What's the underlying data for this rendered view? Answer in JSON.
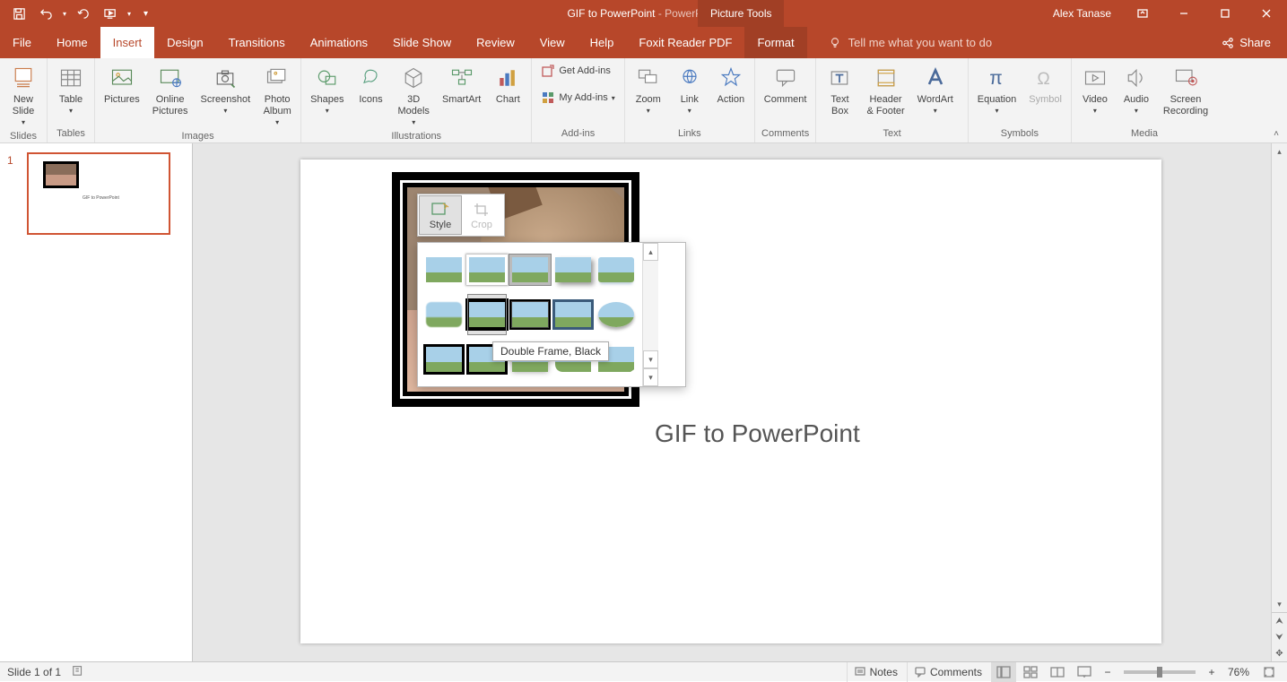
{
  "title": {
    "doc": "GIF to PowerPoint",
    "app": "PowerPoint",
    "sep": "  -  "
  },
  "context_tab": "Picture Tools",
  "user": "Alex Tanase",
  "tabs": {
    "file": "File",
    "home": "Home",
    "insert": "Insert",
    "design": "Design",
    "transitions": "Transitions",
    "animations": "Animations",
    "slideshow": "Slide Show",
    "review": "Review",
    "view": "View",
    "help": "Help",
    "foxit": "Foxit Reader PDF",
    "format": "Format"
  },
  "tellme": "Tell me what you want to do",
  "share": "Share",
  "ribbon": {
    "new_slide": "New\nSlide",
    "slides": "Slides",
    "table": "Table",
    "tables": "Tables",
    "pictures": "Pictures",
    "online_pictures": "Online\nPictures",
    "screenshot": "Screenshot",
    "photo_album": "Photo\nAlbum",
    "images": "Images",
    "shapes": "Shapes",
    "icons": "Icons",
    "models": "3D\nModels",
    "smartart": "SmartArt",
    "chart": "Chart",
    "illustrations": "Illustrations",
    "get_addins": "Get Add-ins",
    "my_addins": "My Add-ins",
    "addins": "Add-ins",
    "zoom": "Zoom",
    "link": "Link",
    "action": "Action",
    "links": "Links",
    "comment": "Comment",
    "comments": "Comments",
    "text_box": "Text\nBox",
    "header_footer": "Header\n& Footer",
    "wordart": "WordArt",
    "text": "Text",
    "equation": "Equation",
    "symbol": "Symbol",
    "symbols": "Symbols",
    "video": "Video",
    "audio": "Audio",
    "screen_rec": "Screen\nRecording",
    "media": "Media"
  },
  "mini": {
    "style": "Style",
    "crop": "Crop"
  },
  "tooltip": "Double Frame, Black",
  "slide_title": "GIF to PowerPoint",
  "thumb": {
    "num": "1"
  },
  "status": {
    "slide": "Slide 1 of 1",
    "notes": "Notes",
    "comments": "Comments",
    "zoom": "76%"
  }
}
